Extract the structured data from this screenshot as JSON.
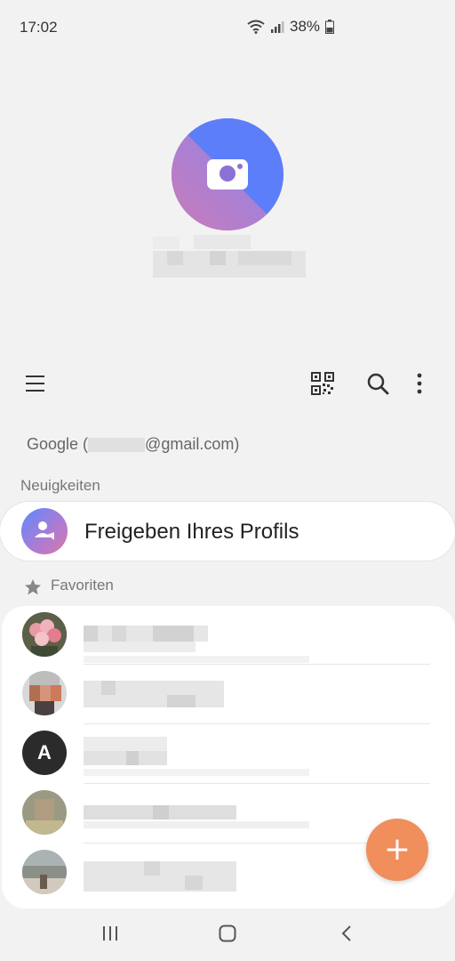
{
  "status_bar": {
    "time": "17:02",
    "battery": "38%",
    "icons": [
      "wifi-icon",
      "signal-icon",
      "battery-icon"
    ]
  },
  "toolbar": {
    "icons": [
      "menu-icon",
      "qr-code-icon",
      "search-icon",
      "more-vert-icon"
    ]
  },
  "account": {
    "label_prefix": "Google (",
    "label_suffix": "@gmail.com)"
  },
  "sections": {
    "news": "Neuigkeiten",
    "favorites": "Favoriten"
  },
  "share_profile": {
    "label": "Freigeben Ihres Profils",
    "icon": "share-profile-icon"
  },
  "favorites": {
    "contacts": [
      {
        "avatar": "photo-flowers"
      },
      {
        "avatar": "photo-person"
      },
      {
        "avatar": "letter",
        "initial": "A"
      },
      {
        "avatar": "photo-person-2"
      },
      {
        "avatar": "photo-landscape"
      }
    ]
  },
  "fab": {
    "label": "+",
    "icon": "add-icon"
  },
  "nav": {
    "icons": [
      "recents-icon",
      "home-icon",
      "back-icon"
    ]
  },
  "colors": {
    "accent": "#f08e5c",
    "background": "#f2f2f2"
  }
}
